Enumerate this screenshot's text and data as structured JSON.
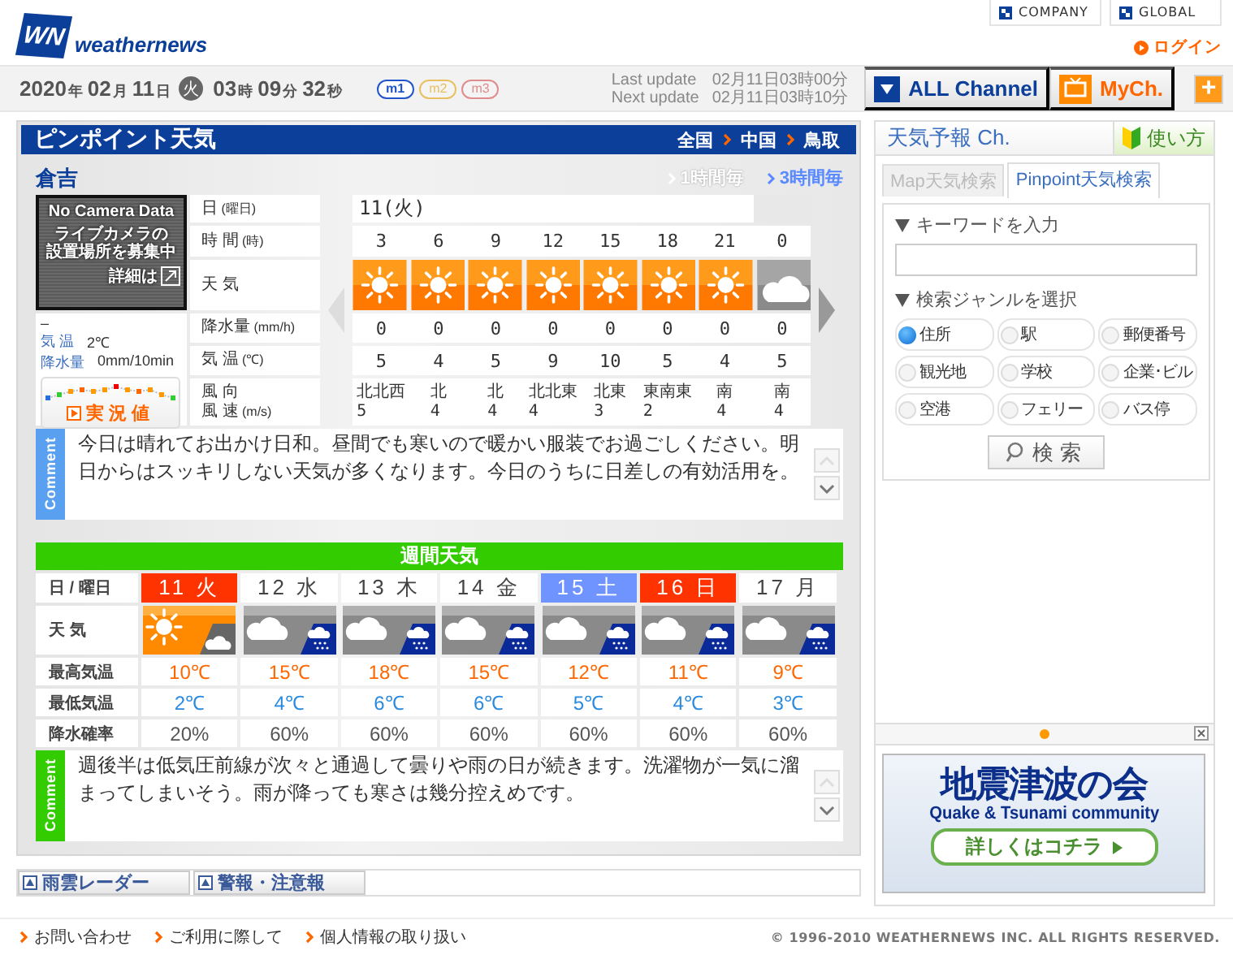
{
  "header": {
    "logo_mark": "WN",
    "logo": "weathernews",
    "links": [
      {
        "label": "COMPANY"
      },
      {
        "label": "GLOBAL"
      }
    ],
    "login": "ログイン"
  },
  "datebar": {
    "date": [
      {
        "value": "2020",
        "unit": "年"
      },
      {
        "value": "02",
        "unit": "月"
      },
      {
        "value": "11",
        "unit": "日"
      }
    ],
    "weekday": "火",
    "time": [
      {
        "value": "03",
        "unit": "時"
      },
      {
        "value": "09",
        "unit": "分"
      },
      {
        "value": "32",
        "unit": "秒"
      }
    ],
    "modes": [
      {
        "label": "m1",
        "selected": true,
        "color": "#2255cc"
      },
      {
        "label": "m2",
        "selected": false,
        "color": "#e8c060"
      },
      {
        "label": "m3",
        "selected": false,
        "color": "#e08c8c"
      }
    ],
    "updates": [
      {
        "label": "Last update",
        "value": "02月11日03時00分"
      },
      {
        "label": "Next update",
        "value": "02月11日03時10分"
      }
    ],
    "channels": [
      {
        "label": "ALL Channel",
        "kind": "all"
      },
      {
        "label": "MyCh.",
        "kind": "my"
      }
    ],
    "add": "+"
  },
  "pinpoint": {
    "title": "ピンポイント天気",
    "breadcrumb": [
      "全国",
      "中国",
      "鳥取"
    ],
    "location": "倉吉",
    "intervals": [
      {
        "label": "1時間毎",
        "selected": false
      },
      {
        "label": "3時間毎",
        "selected": true
      }
    ],
    "camera": {
      "title": "No Camera Data",
      "message": [
        "ライブカメラの",
        "設置場所を募集中"
      ],
      "link": "詳細は"
    },
    "observation": {
      "dash": "–",
      "rows": [
        {
          "label": "気 温",
          "value": "2℃"
        },
        {
          "label": "降水量",
          "value": "0mm/10min"
        }
      ],
      "button": "実況値"
    },
    "row_labels": [
      {
        "lines": [
          "日"
        ],
        "unit": "(曜日)"
      },
      {
        "lines": [
          "時 間"
        ],
        "unit": "(時)"
      },
      {
        "lines": [
          "天 気"
        ]
      },
      {
        "lines": [
          "降水量"
        ],
        "unit": "(mm/h)"
      },
      {
        "lines": [
          "気 温"
        ],
        "unit": "(℃)"
      },
      {
        "lines": [
          "風 向",
          "風 速"
        ],
        "unit": "(m/s)"
      }
    ],
    "date": "11(火)",
    "hours": [
      {
        "time": "3",
        "kind": "sunny",
        "precip": "0",
        "temp": "5",
        "wind_dir": "北北西",
        "wind_speed": "5"
      },
      {
        "time": "6",
        "kind": "sunny",
        "precip": "0",
        "temp": "4",
        "wind_dir": "北",
        "wind_speed": "4"
      },
      {
        "time": "9",
        "kind": "sunny",
        "precip": "0",
        "temp": "5",
        "wind_dir": "北",
        "wind_speed": "4"
      },
      {
        "time": "12",
        "kind": "sunny",
        "precip": "0",
        "temp": "9",
        "wind_dir": "北北東",
        "wind_speed": "4"
      },
      {
        "time": "15",
        "kind": "sunny",
        "precip": "0",
        "temp": "10",
        "wind_dir": "北東",
        "wind_speed": "3"
      },
      {
        "time": "18",
        "kind": "sunny",
        "precip": "0",
        "temp": "5",
        "wind_dir": "東南東",
        "wind_speed": "2"
      },
      {
        "time": "21",
        "kind": "sunny",
        "precip": "0",
        "temp": "4",
        "wind_dir": "南",
        "wind_speed": "4"
      },
      {
        "time": "0",
        "kind": "cloudy",
        "precip": "0",
        "temp": "5",
        "wind_dir": "南",
        "wind_speed": "4"
      }
    ],
    "comment_tab": "Comment",
    "comment": "今日は晴れてお出かけ日和。昼間でも寒いので暖かい服装でお過ごしください。明日からはスッキリしない天気が多くなります。今日のうちに日差しの有効活用を。"
  },
  "weekly": {
    "title": "週間天気",
    "row_labels": [
      "日 / 曜日",
      "天 気",
      "最高気温",
      "最低気温",
      "降水確率"
    ],
    "days": [
      {
        "day": "11",
        "weekday": "火",
        "color": "#ff3300",
        "kind": "sunny_cloudy",
        "high": "10℃",
        "low": "2℃",
        "pop": "20%"
      },
      {
        "day": "12",
        "weekday": "水",
        "color": "#ffffff",
        "kind": "cloudy_rain",
        "high": "15℃",
        "low": "4℃",
        "pop": "60%"
      },
      {
        "day": "13",
        "weekday": "木",
        "color": "#ffffff",
        "kind": "cloudy_rain",
        "high": "18℃",
        "low": "6℃",
        "pop": "60%"
      },
      {
        "day": "14",
        "weekday": "金",
        "color": "#ffffff",
        "kind": "cloudy_rain",
        "high": "15℃",
        "low": "6℃",
        "pop": "60%"
      },
      {
        "day": "15",
        "weekday": "土",
        "color": "#6f93ff",
        "kind": "cloudy_rain",
        "high": "12℃",
        "low": "5℃",
        "pop": "60%"
      },
      {
        "day": "16",
        "weekday": "日",
        "color": "#ff3300",
        "kind": "cloudy_rain",
        "high": "11℃",
        "low": "4℃",
        "pop": "60%"
      },
      {
        "day": "17",
        "weekday": "月",
        "color": "#ffffff",
        "kind": "cloudy_rain",
        "high": "9℃",
        "low": "3℃",
        "pop": "60%"
      }
    ],
    "comment_tab": "Comment",
    "comment": "週後半は低気圧前線が次々と通過して曇りや雨の日が続きます。洗濯物が一気に溜まってしまいそう。雨が降っても寒さは幾分控えめです。"
  },
  "bottom_tabs": [
    "雨雲レーダー",
    "警報・注意報"
  ],
  "side": {
    "title": "天気予報 Ch.",
    "help": "使い方",
    "tabs": [
      {
        "label": "Map天気検索",
        "selected": false
      },
      {
        "label": "Pinpoint天気検索",
        "selected": true
      }
    ],
    "keyword_label": "キーワードを入力",
    "genre_label": "検索ジャンルを選択",
    "genres": [
      {
        "label": "住所",
        "selected": true
      },
      {
        "label": "駅",
        "selected": false
      },
      {
        "label": "郵便番号",
        "selected": false
      },
      {
        "label": "観光地",
        "selected": false
      },
      {
        "label": "学校",
        "selected": false
      },
      {
        "label": "企業･ビル",
        "selected": false
      },
      {
        "label": "空港",
        "selected": false
      },
      {
        "label": "フェリー",
        "selected": false
      },
      {
        "label": "バス停",
        "selected": false
      }
    ],
    "search": "検索"
  },
  "ad": {
    "title": "地震津波の会",
    "subtitle": "Quake & Tsunami community",
    "button": "詳しくはコチラ"
  },
  "footer": {
    "links": [
      "お問い合わせ",
      "ご利用に際して",
      "個人情報の取り扱い"
    ],
    "copyright": "© 1996-2010 WEATHERNEWS INC. ALL RIGHTS RESERVED."
  }
}
